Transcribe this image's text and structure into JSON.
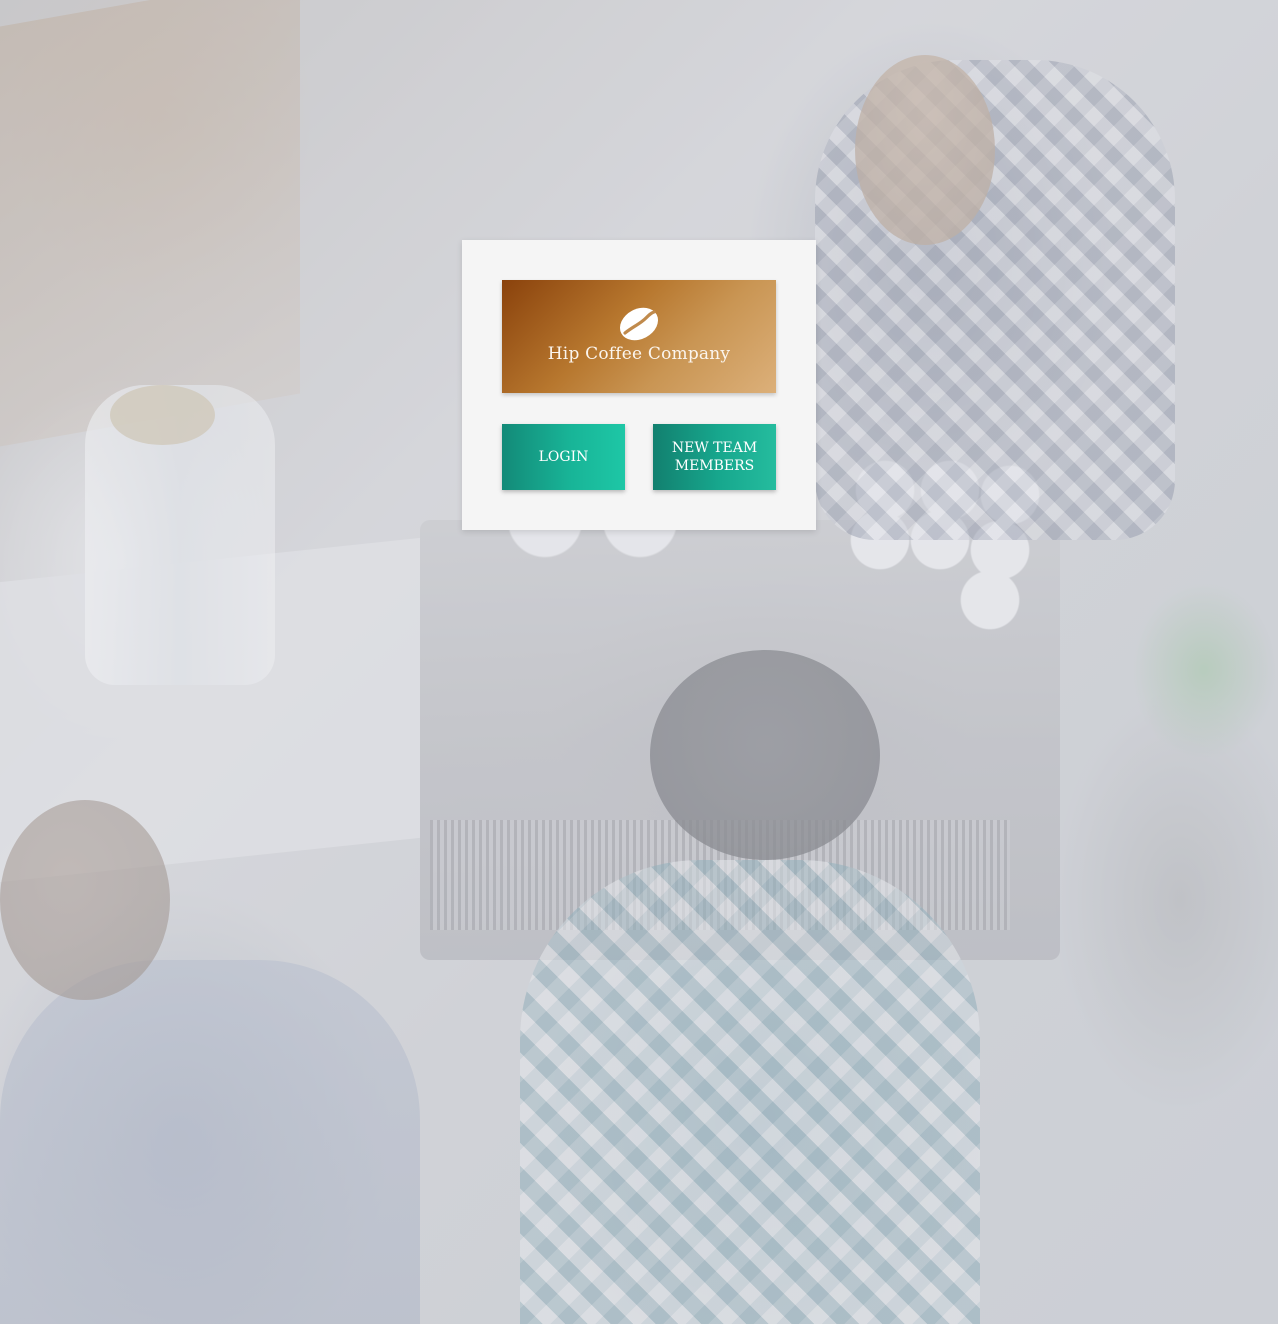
{
  "brand": {
    "name": "Hip Coffee Company",
    "icon": "coffee-bean-icon",
    "gradient_colors": [
      "#8a420c",
      "#dcb07a"
    ]
  },
  "actions": {
    "login_label": "LOGIN",
    "new_team_label": "NEW TEAM MEMBERS"
  },
  "colors": {
    "button_accent": "#18b497",
    "card_background": "#f5f5f5"
  },
  "background": {
    "icon": "cafe-photo"
  }
}
